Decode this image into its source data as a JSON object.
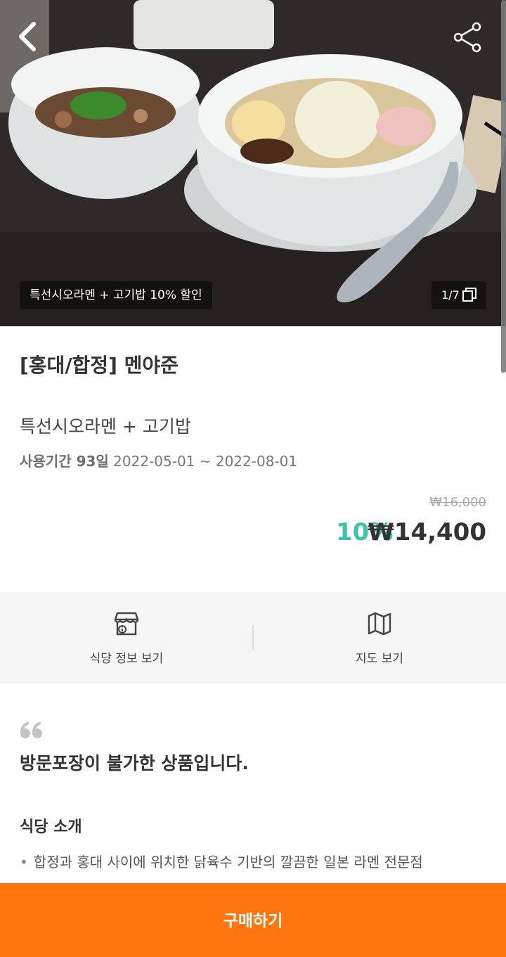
{
  "hero": {
    "caption": "특선시오라멘 + 고기밥 10% 할인",
    "counter": "1/7",
    "back_icon": "chevron-left-icon",
    "share_icon": "share-icon"
  },
  "product": {
    "restaurant": "[홍대/합정] 멘야준",
    "name": "특선시오라멘 + 고기밥",
    "period_label": "사용기간 93일",
    "period_dates": "2022-05-01 ~ 2022-08-01",
    "original_price": "₩16,000",
    "discount": "10%",
    "final_price": "₩14,400"
  },
  "actions": {
    "restaurant_info": "식당 정보 보기",
    "map": "지도 보기"
  },
  "notice": {
    "text": "방문포장이 불가한 상품입니다.",
    "intro_title": "식당 소개",
    "intro_item": "합정과 홍대 사이에 위치한 닭육수 기반의 깔끔한 일본 라멘 전문점"
  },
  "buy_button": "구매하기",
  "colors": {
    "accent": "#ff7510",
    "discount": "#3cc6a8"
  }
}
